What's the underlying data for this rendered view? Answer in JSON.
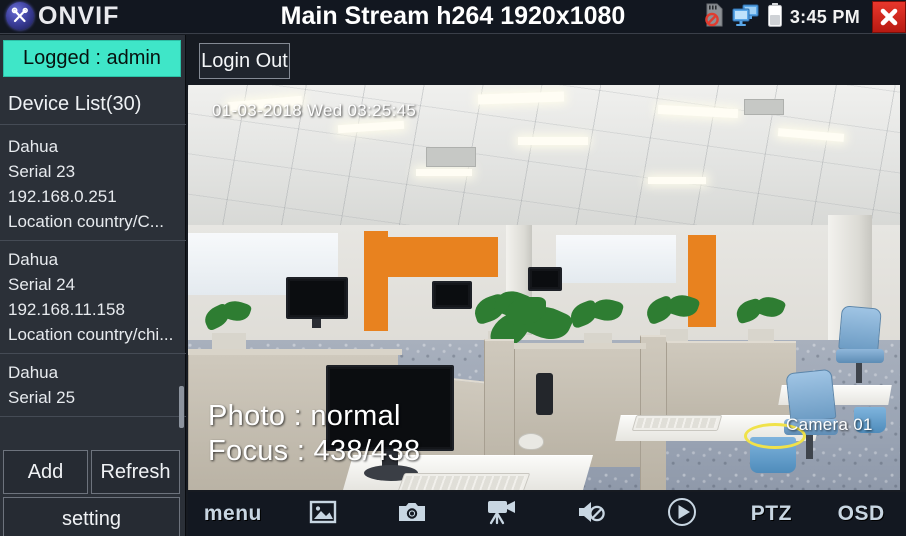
{
  "titlebar": {
    "logo_text": "ONVIF",
    "logo_icon": "onvif-tools-icon",
    "title": "Main Stream h264 1920x1080",
    "status_icons": [
      {
        "name": "sdcard-disabled-icon"
      },
      {
        "name": "network-monitors-icon"
      },
      {
        "name": "battery-icon"
      }
    ],
    "clock": "3:45 PM",
    "close_icon": "close-icon"
  },
  "sidebar": {
    "logged_label": "Logged : admin",
    "device_list_header": "Device List(30)",
    "devices": [
      {
        "name": "Dahua",
        "serial": "Serial  23",
        "ip": "192.168.0.251",
        "location": "Location  country/C..."
      },
      {
        "name": "Dahua",
        "serial": "Serial  24",
        "ip": "192.168.11.158",
        "location": "Location  country/chi..."
      },
      {
        "name": "Dahua",
        "serial": "Serial  25",
        "ip": "",
        "location": ""
      }
    ],
    "buttons": {
      "add": "Add",
      "refresh": "Refresh",
      "setting": "setting"
    }
  },
  "content": {
    "login_out": "Login Out"
  },
  "video_overlay": {
    "timestamp": "01-03-2018 Wed 03:25:45",
    "photo": "Photo : normal",
    "focus": "Focus : 438/438",
    "camera": "Camera 01"
  },
  "toolbar": {
    "items": [
      {
        "name": "menu-button",
        "label": "menu",
        "icon": ""
      },
      {
        "name": "gallery-button",
        "label": "",
        "icon": "image-icon"
      },
      {
        "name": "snapshot-button",
        "label": "",
        "icon": "camera-icon"
      },
      {
        "name": "record-button",
        "label": "",
        "icon": "video-camera-icon"
      },
      {
        "name": "audio-mute-button",
        "label": "",
        "icon": "speaker-mute-icon"
      },
      {
        "name": "play-button",
        "label": "",
        "icon": "play-circle-icon"
      },
      {
        "name": "ptz-button",
        "label": "PTZ",
        "icon": ""
      },
      {
        "name": "osd-button",
        "label": "OSD",
        "icon": ""
      }
    ]
  },
  "colors": {
    "accent_logged": "#3fe6c8",
    "close_red": "#e8372c",
    "titlebar_bg": "#121720",
    "sidebar_bg": "#2b3038",
    "toolbar_bg": "#131821",
    "toolbar_icon": "#c8d6e2"
  }
}
